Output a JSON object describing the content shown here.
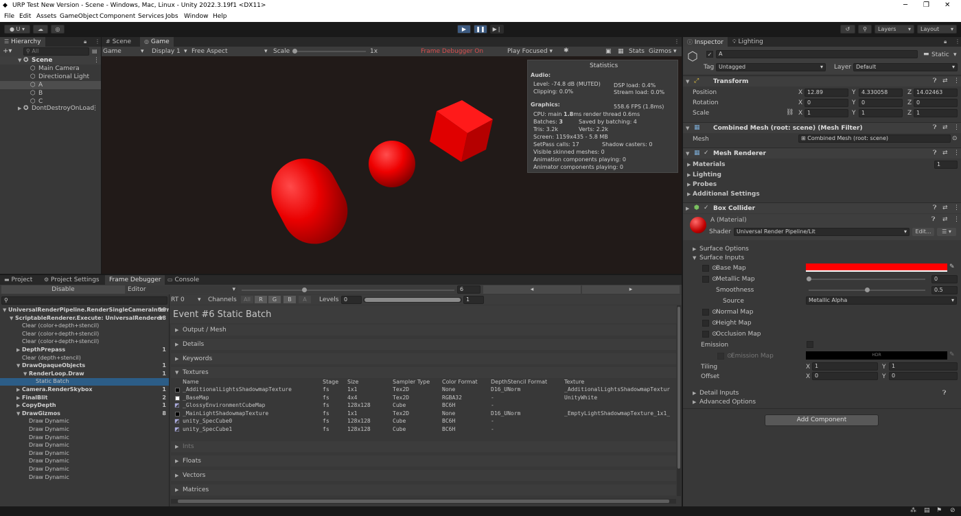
{
  "window": {
    "title": "URP Test New Version - Scene - Windows, Mac, Linux - Unity 2022.3.19f1 <DX11>"
  },
  "menu": [
    "File",
    "Edit",
    "Assets",
    "GameObject",
    "Component",
    "Services",
    "Jobs",
    "Window",
    "Help"
  ],
  "toolbar": {
    "account": "U",
    "layers": "Layers",
    "layout": "Layout"
  },
  "hierarchy": {
    "tab": "Hierarchy",
    "search_placeholder": "All",
    "root": "Scene",
    "items": [
      "Main Camera",
      "Directional Light",
      "A",
      "B",
      "C"
    ],
    "dont_destroy": "DontDestroyOnLoad"
  },
  "game": {
    "tabs": [
      "Scene",
      "Game"
    ],
    "toolbar": {
      "mode": "Game",
      "display": "Display 1",
      "aspect": "Free Aspect",
      "scale_label": "Scale",
      "scale_value": "1x",
      "frame_debugger": "Frame Debugger On",
      "play_mode": "Play Focused",
      "stats": "Stats",
      "gizmos": "Gizmos"
    },
    "stats": {
      "title": "Statistics",
      "audio_header": "Audio:",
      "level": "Level: -74.8 dB (MUTED)",
      "dsp": "DSP load: 0.4%",
      "clipping": "Clipping: 0.0%",
      "stream": "Stream load: 0.0%",
      "graphics_header": "Graphics:",
      "fps": "558.6 FPS (1.8ms)",
      "cpu_prefix": "CPU: main ",
      "cpu_value": "1.8",
      "cpu_suffix": "ms  render thread 0.6ms",
      "batches_prefix": "Batches: ",
      "batches_value": "3",
      "saved": "Saved by batching: 4",
      "tris": "Tris: 3.2k",
      "verts": "Verts: 2.2k",
      "screen": "Screen: 1159x435 - 5.8 MB",
      "setpass": "SetPass calls: 17",
      "shadow": "Shadow casters: 0",
      "skinned": "Visible skinned meshes: 0",
      "anim": "Animation components playing: 0",
      "animator": "Animator components playing: 0"
    }
  },
  "bottom_tabs": [
    "Project",
    "Project Settings",
    "Frame Debugger",
    "Console"
  ],
  "frame_debugger": {
    "disable": "Disable",
    "editor": "Editor",
    "event_index": "6",
    "rt": "RT 0",
    "channels_label": "Channels",
    "channels": [
      "All",
      "R",
      "G",
      "B",
      "A"
    ],
    "levels_label": "Levels",
    "levels_min": "0",
    "levels_max": "1",
    "event_title": "Event #6 Static Batch",
    "tree": [
      {
        "label": "UniversalRenderPipeline.RenderSingleCameraInterr",
        "count": "18",
        "indent": 0,
        "bold": true,
        "open": true
      },
      {
        "label": "ScriptableRenderer.Execute: UniversalRenderer",
        "count": "18",
        "indent": 1,
        "bold": true,
        "open": true
      },
      {
        "label": "Clear (color+depth+stencil)",
        "count": "",
        "indent": 2,
        "bold": false
      },
      {
        "label": "Clear (color+depth+stencil)",
        "count": "",
        "indent": 2,
        "bold": false
      },
      {
        "label": "Clear (color+depth+stencil)",
        "count": "",
        "indent": 2,
        "bold": false
      },
      {
        "label": "DepthPrepass",
        "count": "1",
        "indent": 2,
        "bold": true,
        "open": false
      },
      {
        "label": "Clear (depth+stencil)",
        "count": "",
        "indent": 2,
        "bold": false
      },
      {
        "label": "DrawOpaqueObjects",
        "count": "1",
        "indent": 2,
        "bold": true,
        "open": true
      },
      {
        "label": "RenderLoop.Draw",
        "count": "1",
        "indent": 3,
        "bold": true,
        "open": true
      },
      {
        "label": "Static Batch",
        "count": "",
        "indent": 4,
        "bold": false,
        "selected": true
      },
      {
        "label": "Camera.RenderSkybox",
        "count": "1",
        "indent": 2,
        "bold": true,
        "open": false
      },
      {
        "label": "FinalBlit",
        "count": "2",
        "indent": 2,
        "bold": true,
        "open": false
      },
      {
        "label": "CopyDepth",
        "count": "1",
        "indent": 2,
        "bold": true,
        "open": false
      },
      {
        "label": "DrawGizmos",
        "count": "8",
        "indent": 2,
        "bold": true,
        "open": true
      },
      {
        "label": "Draw Dynamic",
        "count": "",
        "indent": 3,
        "bold": false
      },
      {
        "label": "Draw Dynamic",
        "count": "",
        "indent": 3,
        "bold": false
      },
      {
        "label": "Draw Dynamic",
        "count": "",
        "indent": 3,
        "bold": false
      },
      {
        "label": "Draw Dynamic",
        "count": "",
        "indent": 3,
        "bold": false
      },
      {
        "label": "Draw Dynamic",
        "count": "",
        "indent": 3,
        "bold": false
      },
      {
        "label": "Draw Dynamic",
        "count": "",
        "indent": 3,
        "bold": false
      },
      {
        "label": "Draw Dynamic",
        "count": "",
        "indent": 3,
        "bold": false
      },
      {
        "label": "Draw Dynamic",
        "count": "",
        "indent": 3,
        "bold": false
      }
    ],
    "sections_top": [
      "Output / Mesh",
      "Details",
      "Keywords"
    ],
    "textures_header": "Textures",
    "tex_columns": [
      "Name",
      "Stage",
      "Size",
      "Sampler Type",
      "Color Format",
      "DepthStencil Format",
      "Texture"
    ],
    "textures": [
      {
        "name": "_AdditionalLightsShadowmapTexture",
        "stage": "fs",
        "size": "1x1",
        "sampler": "Tex2D",
        "color": "None",
        "depth": "D16_UNorm",
        "texture": "_AdditionalLightsShadowmapTextur",
        "swatch": "black"
      },
      {
        "name": "_BaseMap",
        "stage": "fs",
        "size": "4x4",
        "sampler": "Tex2D",
        "color": "RGBA32",
        "depth": "-",
        "texture": "UnityWhite",
        "swatch": "white"
      },
      {
        "name": "_GlossyEnvironmentCubeMap",
        "stage": "fs",
        "size": "128x128",
        "sampler": "Cube",
        "color": "BC6H",
        "depth": "-",
        "texture": "",
        "swatch": "cube"
      },
      {
        "name": "_MainLightShadowmapTexture",
        "stage": "fs",
        "size": "1x1",
        "sampler": "Tex2D",
        "color": "None",
        "depth": "D16_UNorm",
        "texture": "_EmptyLightShadowmapTexture_1x1_",
        "swatch": "black"
      },
      {
        "name": "unity_SpecCube0",
        "stage": "fs",
        "size": "128x128",
        "sampler": "Cube",
        "color": "BC6H",
        "depth": "-",
        "texture": "",
        "swatch": "cube"
      },
      {
        "name": "unity_SpecCube1",
        "stage": "fs",
        "size": "128x128",
        "sampler": "Cube",
        "color": "BC6H",
        "depth": "-",
        "texture": "",
        "swatch": "cube"
      }
    ],
    "sections_bottom": [
      {
        "label": "Ints",
        "dim": true
      },
      {
        "label": "Floats",
        "dim": false
      },
      {
        "label": "Vectors",
        "dim": false
      },
      {
        "label": "Matrices",
        "dim": false
      }
    ]
  },
  "inspector": {
    "tabs": [
      "Inspector",
      "Lighting"
    ],
    "object_name": "A",
    "static_label": "Static",
    "tag_label": "Tag",
    "tag_value": "Untagged",
    "layer_label": "Layer",
    "layer_value": "Default",
    "transform": {
      "title": "Transform",
      "position": {
        "label": "Position",
        "x": "12.89",
        "y": "4.330058",
        "z": "14.02463"
      },
      "rotation": {
        "label": "Rotation",
        "x": "0",
        "y": "0",
        "z": "0"
      },
      "scale": {
        "label": "Scale",
        "x": "1",
        "y": "1",
        "z": "1"
      }
    },
    "mesh_filter": {
      "title": "Combined Mesh (root: scene) (Mesh Filter)",
      "mesh_label": "Mesh",
      "mesh_value": "Combined Mesh (root: scene)"
    },
    "mesh_renderer": {
      "title": "Mesh Renderer",
      "materials_label": "Materials",
      "materials_count": "1",
      "lighting": "Lighting",
      "probes": "Probes",
      "additional": "Additional Settings"
    },
    "box_collider": {
      "title": "Box Collider"
    },
    "material": {
      "name": "A (Material)",
      "shader_label": "Shader",
      "shader_value": "Universal Render Pipeline/Lit",
      "edit_label": "Edit..."
    },
    "surface_options": "Surface Options",
    "surface_inputs": "Surface Inputs",
    "base_map": "Base Map",
    "base_color": "#ff0000",
    "metallic_map": "Metallic Map",
    "metallic_value": "0",
    "smoothness_label": "Smoothness",
    "smoothness_value": "0.5",
    "source_label": "Source",
    "source_value": "Metallic Alpha",
    "normal_map": "Normal Map",
    "height_map": "Height Map",
    "occlusion_map": "Occlusion Map",
    "emission_label": "Emission",
    "emission_map": "Emission Map",
    "hdr_label": "HDR",
    "tiling_label": "Tiling",
    "tiling_x": "1",
    "tiling_y": "1",
    "offset_label": "Offset",
    "offset_x": "0",
    "offset_y": "0",
    "detail_inputs": "Detail Inputs",
    "advanced_options": "Advanced Options",
    "add_component": "Add Component"
  },
  "colors": {
    "accent": "#2c5d87",
    "red": "#ff0000",
    "panel": "#383838"
  }
}
